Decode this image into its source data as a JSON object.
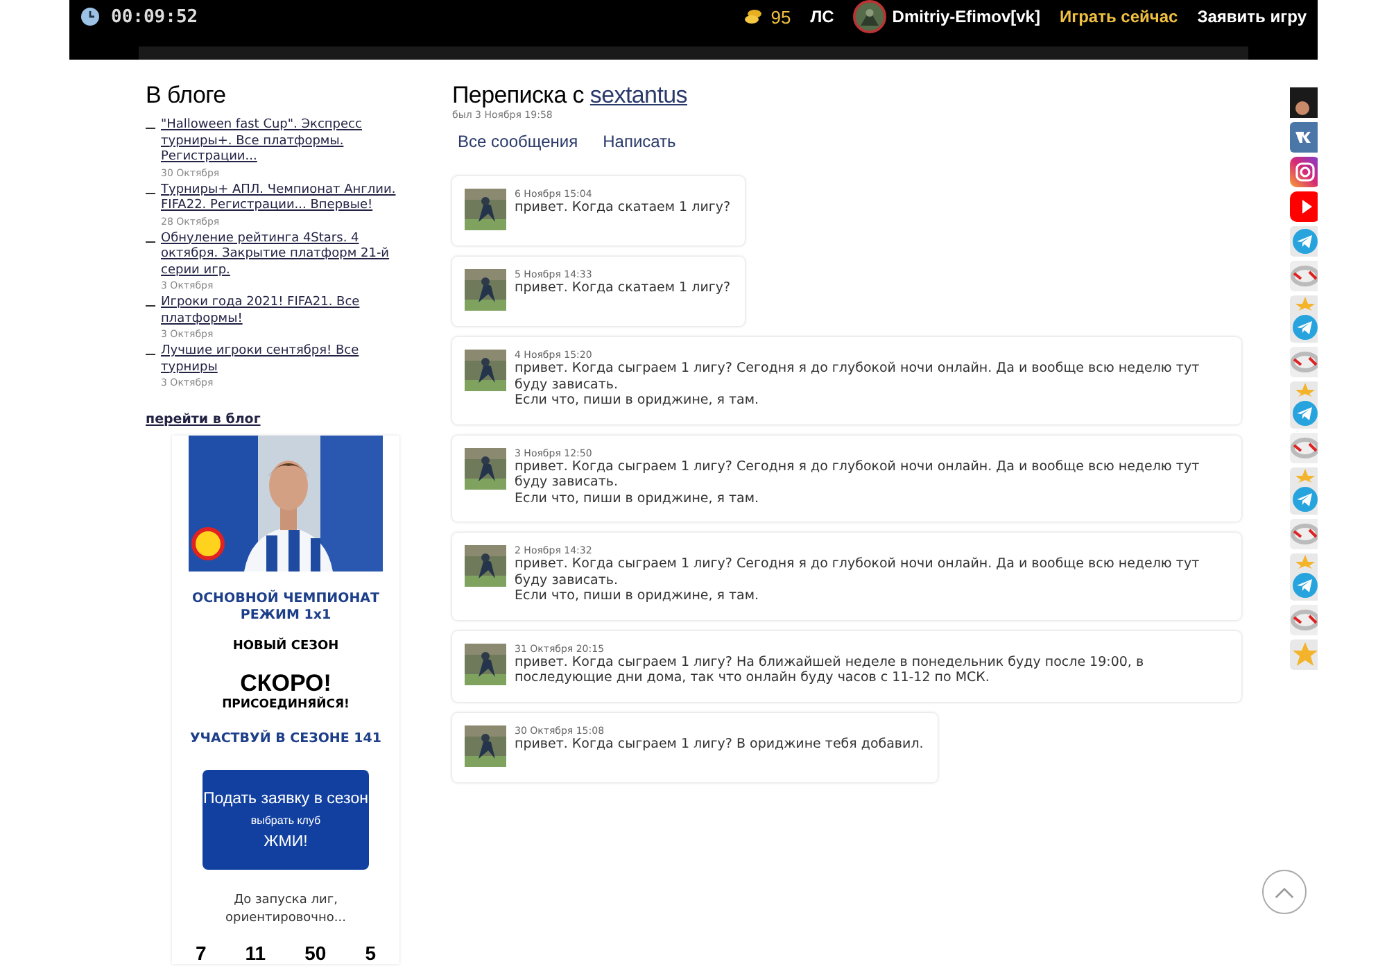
{
  "top_bar": {
    "timer": "00:09:52",
    "coins": "95",
    "messages_link": "ЛС",
    "username": "Dmitriy-Efimov[vk]",
    "play_now": "Играть сейчас",
    "announce": "Заявить игру"
  },
  "blog": {
    "title": "В блоге",
    "posts": [
      {
        "title": "\"Halloween fast Cup\". Экспресс турниры+. Все платформы. Регистрации...",
        "date": "30 Октября"
      },
      {
        "title": "Турниры+ АПЛ. Чемпионат Англии. FIFA22. Регистрации... Впервые!",
        "date": "28 Октября"
      },
      {
        "title": "Обнуление рейтинга 4Stars. 4 октября. Закрытие платформ 21-й серии игр.",
        "date": "3 Октября"
      },
      {
        "title": "Игроки года 2021! FIFA21. Все платформы!",
        "date": "3 Октября"
      },
      {
        "title": "Лучшие игроки сентября! Все турниры",
        "date": "3 Октября"
      }
    ],
    "more_link": "перейти в блог"
  },
  "promo": {
    "banner": {
      "kind": "picture"
    },
    "championship": "ОСНОВНОЙ ЧЕМПИОНАТ РЕЖИМ 1x1",
    "season_label": "НОВЫЙ СЕЗОН",
    "status": "СКОРО!",
    "call": "ПРИСОЕДИНЯЙСЯ!",
    "participate": "УЧАСТВУЙ В СЕЗОНЕ 141",
    "apply_button": [
      "Подать заявку в сезон",
      "выбрать клуб",
      "ЖМИ!"
    ],
    "countdown_caption": "До запуска лиг, ориентировочно...",
    "countdown": [
      "7",
      "11",
      "50",
      "5"
    ]
  },
  "conversation": {
    "title": "Переписка с",
    "partner": "sextantus",
    "last_seen": "был 3 Ноября 19:58",
    "actions": [
      "Все сообщения",
      "Написать"
    ],
    "messages": [
      {
        "date": "6 Ноября 15:04",
        "lines": [
          "привет. Когда скатаем 1 лигу?"
        ]
      },
      {
        "date": "5 Ноября 14:33",
        "lines": [
          "привет. Когда скатаем 1 лигу?"
        ]
      },
      {
        "date": "4 Ноября 15:20",
        "lines": [
          "привет. Когда сыграем 1 лигу? Сегодня я до глубокой ночи онлайн. Да и вообще всю неделю тут буду зависать.",
          "Если что, пиши в ориджине, я там."
        ]
      },
      {
        "date": "3 Ноября 12:50",
        "lines": [
          "привет. Когда сыграем 1 лигу? Сегодня я до глубокой ночи онлайн. Да и вообще всю неделю тут буду зависать.",
          "Если что, пиши в ориджине, я там."
        ]
      },
      {
        "date": "2 Ноября 14:32",
        "lines": [
          "привет. Когда сыграем 1 лигу? Сегодня я до глубокой ночи онлайн. Да и вообще всю неделю тут буду зависать.",
          "Если что, пиши в ориджине, я там."
        ]
      },
      {
        "date": "31 Октября 20:15",
        "lines": [
          "привет. Когда сыграем 1 лигу? На ближайшей неделе в понедельник буду после 19:00, в последующие дни дома, так что онлайн буду часов с 11-12 по МСК."
        ]
      },
      {
        "date": "30 Октября 15:08",
        "lines": [
          "привет. Когда сыграем 1 лигу? В ориджине тебя добавил."
        ]
      }
    ]
  }
}
